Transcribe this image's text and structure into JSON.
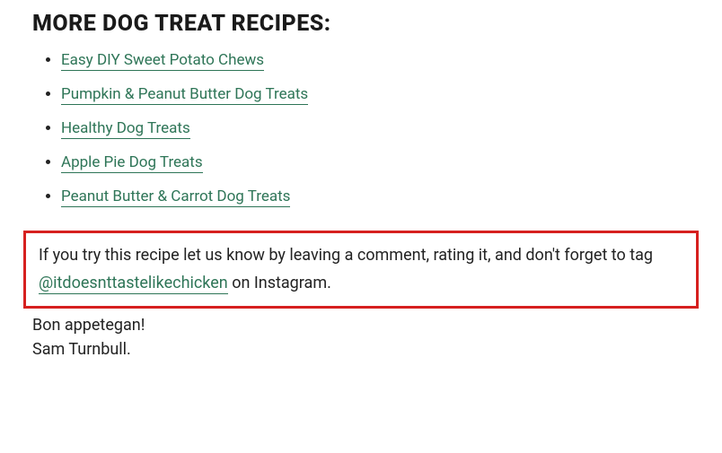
{
  "heading": "MORE DOG TREAT RECIPES:",
  "recipes": [
    {
      "label": "Easy DIY Sweet Potato Chews"
    },
    {
      "label": "Pumpkin & Peanut Butter Dog Treats"
    },
    {
      "label": "Healthy Dog Treats"
    },
    {
      "label": "Apple Pie Dog Treats"
    },
    {
      "label": "Peanut Butter & Carrot Dog Treats"
    }
  ],
  "cta": {
    "before": "If you try this recipe let us know by leaving a comment, rating it, and don't forget to tag ",
    "handle": "@itdoesnttastelikechicken",
    "after": " on Instagram."
  },
  "signoff": "Bon appetegan!",
  "author": "Sam Turnbull."
}
